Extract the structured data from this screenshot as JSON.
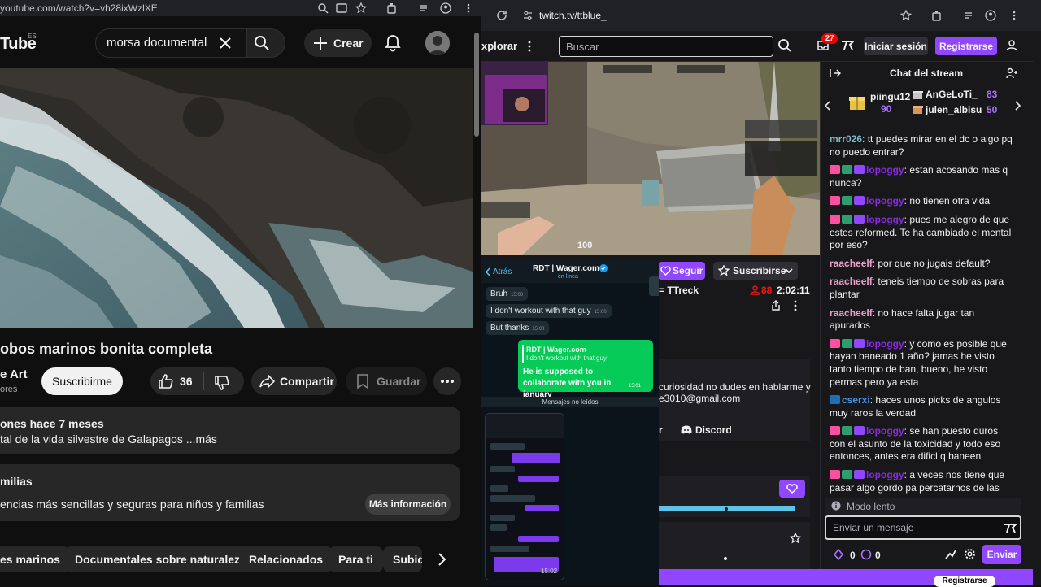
{
  "youtube": {
    "url": "youtube.com/watch?v=vh28ixWzlXE",
    "logo_text": "Tube",
    "logo_region": "ES",
    "search_value": "morsa documental",
    "create_label": "Crear",
    "video_title": "obos marinos bonita completa",
    "channel_name": "e Art",
    "subscribers": "ores",
    "subscribe_label": "Suscribirme",
    "like_count": "36",
    "share_label": "Compartir",
    "save_label": "Guardar",
    "desc_meta": "ones  hace 7 meses",
    "desc_text": "tal de la vida silvestre de Galapagos ...más",
    "info_title": "milias",
    "info_text": "encias más sencillas y seguras para niños y familias",
    "info_button": "Más información",
    "chips": [
      "es marinos",
      "Documentales sobre naturaleza",
      "Relacionados",
      "Para ti",
      "Subid"
    ]
  },
  "twitch": {
    "url": "twitch.tv/ttblue_",
    "explore_label": "xplorar",
    "search_placeholder": "Buscar",
    "notif_count": "27",
    "login_label": "Iniciar sesión",
    "register_label": "Registrarse",
    "hp": "100",
    "follow_label": "Seguir",
    "subscribe_label": "Suscribirse",
    "game_label": "= TTreck",
    "viewers": "88",
    "uptime": "2:02:11",
    "about_line1": "curiosidad no dudes en hablarme y",
    "about_line2": "e3010@gmail.com",
    "about_r": "r",
    "discord_label": "Discord",
    "bottom_button": "Registrarse",
    "chat": {
      "title": "Chat del stream",
      "gifters": [
        {
          "name": "piingu12",
          "count": "90"
        },
        {
          "name": "AnGeLoTi_",
          "count": "83"
        },
        {
          "name": "julen_albisu",
          "count": "50"
        }
      ],
      "messages": [
        {
          "user": "mrr026",
          "color": "#7ab8c8",
          "badges": [],
          "text": ": tt puedes mirar en el dc o algo pq no puedo entrar?"
        },
        {
          "user": "lopoggy",
          "color": "#8a2be2",
          "badges": [
            "#ff4fa0",
            "#2e9e6e",
            "#9147ff"
          ],
          "text": ": estan acosando mas q nunca?"
        },
        {
          "user": "lopoggy",
          "color": "#8a2be2",
          "badges": [
            "#ff4fa0",
            "#2e9e6e",
            "#9147ff"
          ],
          "text": ": no tienen otra vida"
        },
        {
          "user": "lopoggy",
          "color": "#8a2be2",
          "badges": [
            "#ff4fa0",
            "#2e9e6e",
            "#9147ff"
          ],
          "text": ": pues me alegro de que estes reformed. Te ha cambiado el mental por eso?"
        },
        {
          "user": "raacheelf",
          "color": "#e8a0c8",
          "badges": [],
          "text": ": por que no jugais default?"
        },
        {
          "user": "raacheelf",
          "color": "#e8a0c8",
          "badges": [],
          "text": ": teneis tiempo de sobras para plantar"
        },
        {
          "user": "raacheelf",
          "color": "#e8a0c8",
          "badges": [],
          "text": ": no hace falta jugar tan apurados"
        },
        {
          "user": "lopoggy",
          "color": "#8a2be2",
          "badges": [
            "#ff4fa0",
            "#2e9e6e",
            "#9147ff"
          ],
          "text": ": y como es posible que hayan baneado 1 año? jamas he visto tanto tiempo de ban, bueno, he visto permas pero ya esta"
        },
        {
          "user": "cserxi",
          "color": "#4a90e2",
          "badges": [
            "#1f6fb5"
          ],
          "text": ": haces unos picks de angulos muy raros la verdad"
        },
        {
          "user": "lopoggy",
          "color": "#8a2be2",
          "badges": [
            "#ff4fa0",
            "#2e9e6e",
            "#9147ff"
          ],
          "text": ": se han puesto duros con el asunto de la toxicidad y todo eso entonces, antes era dificl q baneen"
        },
        {
          "user": "lopoggy",
          "color": "#8a2be2",
          "badges": [
            "#ff4fa0",
            "#2e9e6e",
            "#9147ff"
          ],
          "text": ": a veces nos tiene que pasar algo gordo pa percatarnos de las cosa"
        }
      ],
      "slow_mode": "Modo lento",
      "input_placeholder": "Enviar un mensaje",
      "points1": "0",
      "points2": "0",
      "send_label": "Enviar"
    }
  },
  "whatsapp": {
    "back_label": "Atrás",
    "contact": "RDT | Wager.com",
    "status": "en línea",
    "messages": [
      {
        "text": "Bruh",
        "time": "15:00"
      },
      {
        "text": "I don't workout with that guy",
        "time": "15:00"
      },
      {
        "text": "But thanks",
        "time": "15:00"
      }
    ],
    "reply_quote_name": "RDT | Wager.com",
    "reply_quote_text": "I don't workout with that guy",
    "reply_text": "He is supposed to collaborate with you in january",
    "reply_time": "15:01",
    "unread_label": "Mensajes no leídos",
    "screenshot_time": "15:02"
  }
}
